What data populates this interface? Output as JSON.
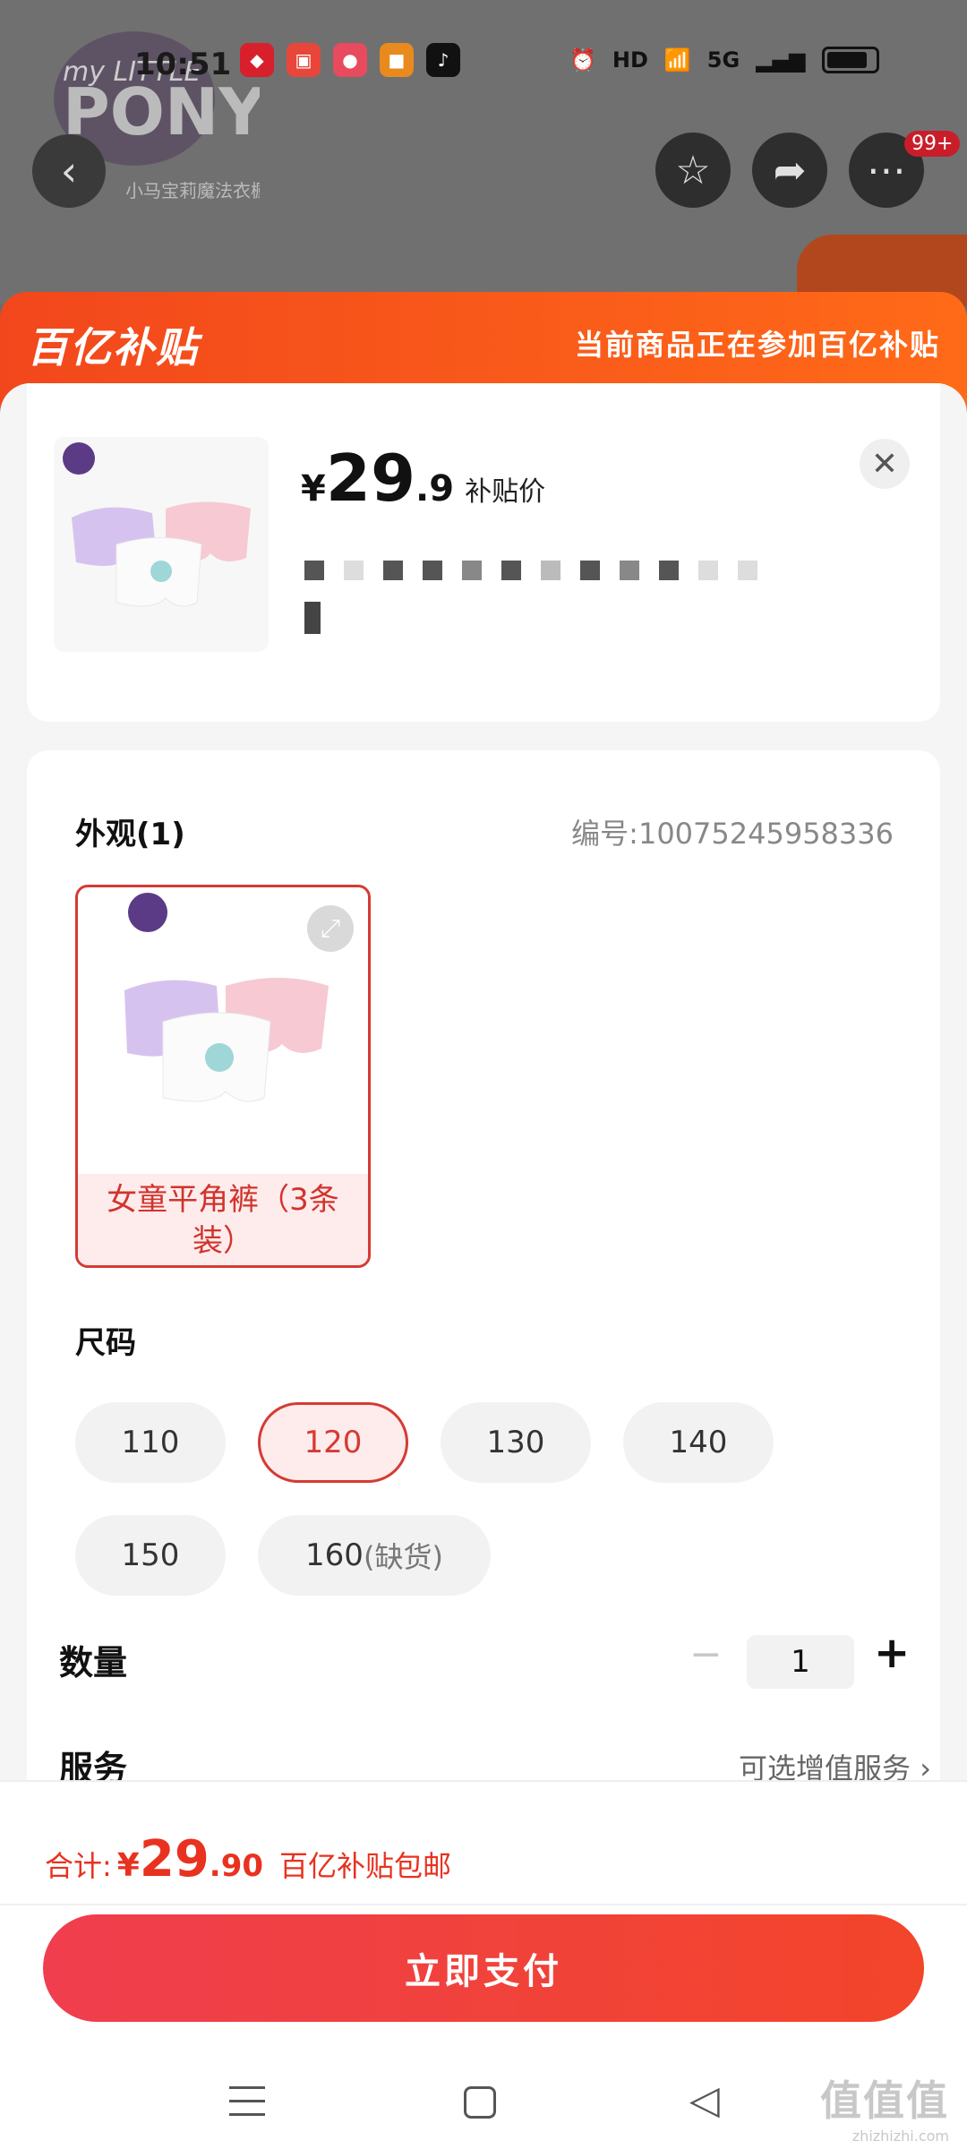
{
  "status_bar": {
    "time": "10:51",
    "hd_label": "HD",
    "network": "5G"
  },
  "background": {
    "brand_logo_text": "my LITTLE PONY",
    "brand_sub_text": "小马宝莉魔法衣橱",
    "badge": "99+"
  },
  "subsidy": {
    "logo": "百亿补贴",
    "notice": "当前商品正在参加百亿补贴"
  },
  "product": {
    "currency": "¥",
    "price_int": "29",
    "price_dec": ".9",
    "price_tag": "补贴价"
  },
  "appearance": {
    "title": "外观(1)",
    "code": "编号:10075245958336",
    "variant_label": "女童平角裤（3条装）"
  },
  "size": {
    "title": "尺码",
    "options": [
      {
        "label": "110",
        "note": ""
      },
      {
        "label": "120",
        "note": ""
      },
      {
        "label": "130",
        "note": ""
      },
      {
        "label": "140",
        "note": ""
      },
      {
        "label": "150",
        "note": ""
      },
      {
        "label": "160",
        "note": "(缺货)"
      }
    ],
    "selected": "120"
  },
  "quantity": {
    "label": "数量",
    "minus": "−",
    "value": "1",
    "plus": "+"
  },
  "service": {
    "label": "服务",
    "value": "可选增值服务",
    "chevron": "›"
  },
  "footer": {
    "total_label": "合计:",
    "currency": "¥",
    "total_int": "29",
    "total_dec": ".90",
    "note": "百亿补贴包邮",
    "pay_button": "立即支付"
  },
  "watermark": {
    "main": "值值值",
    "sub": "zhizhizhi.com"
  },
  "colors": {
    "accent": "#d63a34",
    "subsidy_orange": "#f2471c",
    "pay_red": "#f03e4e"
  }
}
